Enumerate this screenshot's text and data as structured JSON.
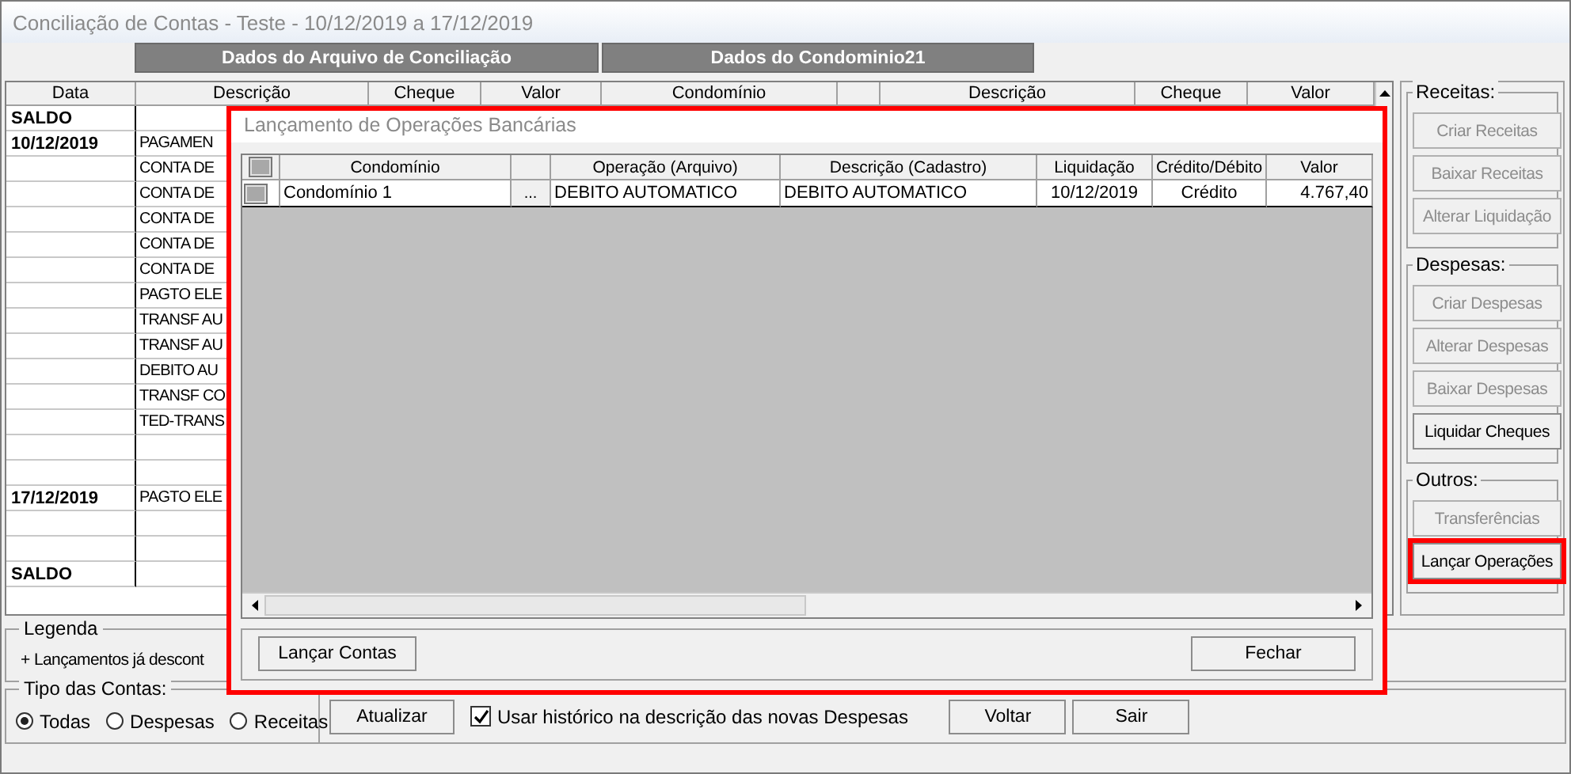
{
  "window": {
    "title": "Conciliação de Contas - Teste - 10/12/2019 a 17/12/2019"
  },
  "group_headers": [
    "Dados do Arquivo de Conciliação",
    "Dados do Condominio21"
  ],
  "grid": {
    "columns": [
      "Data",
      "Descrição",
      "Cheque",
      "Valor",
      "Condomínio",
      "Descrição",
      "Cheque",
      "Valor"
    ],
    "rows": [
      {
        "date": "SALDO"
      },
      {
        "date": "10/12/2019",
        "description": "PAGAMEN"
      },
      {
        "description": "CONTA DE"
      },
      {
        "description": "CONTA DE"
      },
      {
        "description": "CONTA DE"
      },
      {
        "description": "CONTA DE"
      },
      {
        "description": "CONTA DE"
      },
      {
        "description": "PAGTO ELE"
      },
      {
        "description": "TRANSF AU"
      },
      {
        "description": "TRANSF AU"
      },
      {
        "description": "DEBITO AU"
      },
      {
        "description": "TRANSF CO"
      },
      {
        "description": "TED-TRANS"
      },
      {},
      {},
      {
        "date": "17/12/2019",
        "description": "PAGTO ELE"
      },
      {},
      {},
      {
        "date": "SALDO"
      }
    ]
  },
  "side_panel": [
    {
      "title": "Receitas:",
      "buttons": [
        {
          "label": "Criar Receitas",
          "disabled": true,
          "highlighted": false
        },
        {
          "label": "Baixar Receitas",
          "disabled": true,
          "highlighted": false
        },
        {
          "label": "Alterar Liquidação",
          "disabled": true,
          "highlighted": false
        }
      ]
    },
    {
      "title": "Despesas:",
      "buttons": [
        {
          "label": "Criar Despesas",
          "disabled": true,
          "highlighted": false
        },
        {
          "label": "Alterar Despesas",
          "disabled": true,
          "highlighted": false
        },
        {
          "label": "Baixar Despesas",
          "disabled": true,
          "highlighted": false
        },
        {
          "label": "Liquidar Cheques",
          "disabled": false,
          "highlighted": false
        }
      ]
    },
    {
      "title": "Outros:",
      "buttons": [
        {
          "label": "Transferências",
          "disabled": true,
          "highlighted": false
        },
        {
          "label": "Lançar Operações",
          "disabled": false,
          "highlighted": true
        }
      ]
    }
  ],
  "legend": {
    "title": "Legenda",
    "text": "+ Lançamentos já descont"
  },
  "account_type": {
    "title": "Tipo das Contas:",
    "options": [
      {
        "label": "Todas",
        "selected": true
      },
      {
        "label": "Despesas",
        "selected": false
      },
      {
        "label": "Receitas",
        "selected": false
      }
    ]
  },
  "actions": {
    "update_button": "Atualizar",
    "history_option": {
      "label": "Usar histórico na descrição das novas Despesas",
      "checked": true
    },
    "buttons": [
      "Voltar",
      "Sair"
    ]
  },
  "dialog": {
    "title": "Lançamento de Operações Bancárias",
    "highlighted": true,
    "header_checked": false,
    "columns": [
      "Condomínio",
      "Operação (Arquivo)",
      "Descrição (Cadastro)",
      "Liquidação",
      "Crédito/Débito",
      "Valor"
    ],
    "rows": [
      {
        "checked": false,
        "condominio": "Condomínio 1",
        "lookup_button": "...",
        "operacao": "DEBITO AUTOMATICO",
        "descricao": "DEBITO AUTOMATICO",
        "liquidacao": "10/12/2019",
        "tipo": "Crédito",
        "valor": "4.767,40"
      }
    ],
    "buttons": [
      "Lançar Contas",
      "Fechar"
    ]
  }
}
